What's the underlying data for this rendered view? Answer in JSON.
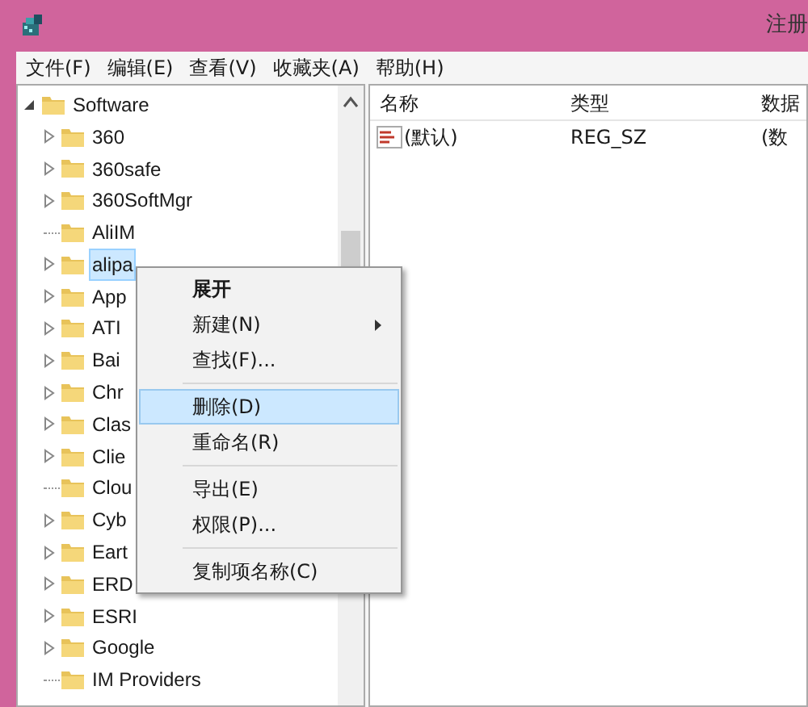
{
  "window": {
    "title": "注册"
  },
  "menu_bar": [
    "文件(F)",
    "编辑(E)",
    "查看(V)",
    "收藏夹(A)",
    "帮助(H)"
  ],
  "tree": {
    "label": "Software",
    "expanded": true,
    "children": [
      {
        "label": "360",
        "has_children": true,
        "selected": false
      },
      {
        "label": "360safe",
        "has_children": true,
        "selected": false
      },
      {
        "label": "360SoftMgr",
        "has_children": true,
        "selected": false
      },
      {
        "label": "AliIM",
        "has_children": false,
        "selected": false
      },
      {
        "label": "alipa",
        "has_children": true,
        "selected": true
      },
      {
        "label": "App",
        "has_children": true,
        "selected": false
      },
      {
        "label": "ATI",
        "has_children": true,
        "selected": false
      },
      {
        "label": "Bai",
        "has_children": true,
        "selected": false
      },
      {
        "label": "Chr",
        "has_children": true,
        "selected": false
      },
      {
        "label": "Clas",
        "has_children": true,
        "selected": false
      },
      {
        "label": "Clie",
        "has_children": true,
        "selected": false
      },
      {
        "label": "Clou",
        "has_children": false,
        "selected": false
      },
      {
        "label": "Cyb",
        "has_children": true,
        "selected": false
      },
      {
        "label": "Eart",
        "has_children": true,
        "selected": false
      },
      {
        "label": "ERD",
        "has_children": true,
        "selected": false
      },
      {
        "label": "ESRI",
        "has_children": true,
        "selected": false
      },
      {
        "label": "Google",
        "has_children": true,
        "selected": false
      },
      {
        "label": "IM Providers",
        "has_children": false,
        "selected": false
      }
    ]
  },
  "values": {
    "columns": [
      "名称",
      "类型",
      "数据"
    ],
    "rows": [
      {
        "name": "(默认)",
        "type": "REG_SZ",
        "data": "(数"
      }
    ]
  },
  "context_menu": [
    {
      "kind": "item",
      "label": "展开",
      "bold": true,
      "submenu": false,
      "selected": false
    },
    {
      "kind": "item",
      "label": "新建(N)",
      "bold": false,
      "submenu": true,
      "selected": false
    },
    {
      "kind": "item",
      "label": "查找(F)...",
      "bold": false,
      "submenu": false,
      "selected": false
    },
    {
      "kind": "separator"
    },
    {
      "kind": "item",
      "label": "删除(D)",
      "bold": false,
      "submenu": false,
      "selected": true
    },
    {
      "kind": "item",
      "label": "重命名(R)",
      "bold": false,
      "submenu": false,
      "selected": false
    },
    {
      "kind": "separator"
    },
    {
      "kind": "item",
      "label": "导出(E)",
      "bold": false,
      "submenu": false,
      "selected": false
    },
    {
      "kind": "item",
      "label": "权限(P)...",
      "bold": false,
      "submenu": false,
      "selected": false
    },
    {
      "kind": "separator"
    },
    {
      "kind": "item",
      "label": "复制项名称(C)",
      "bold": false,
      "submenu": false,
      "selected": false
    }
  ]
}
